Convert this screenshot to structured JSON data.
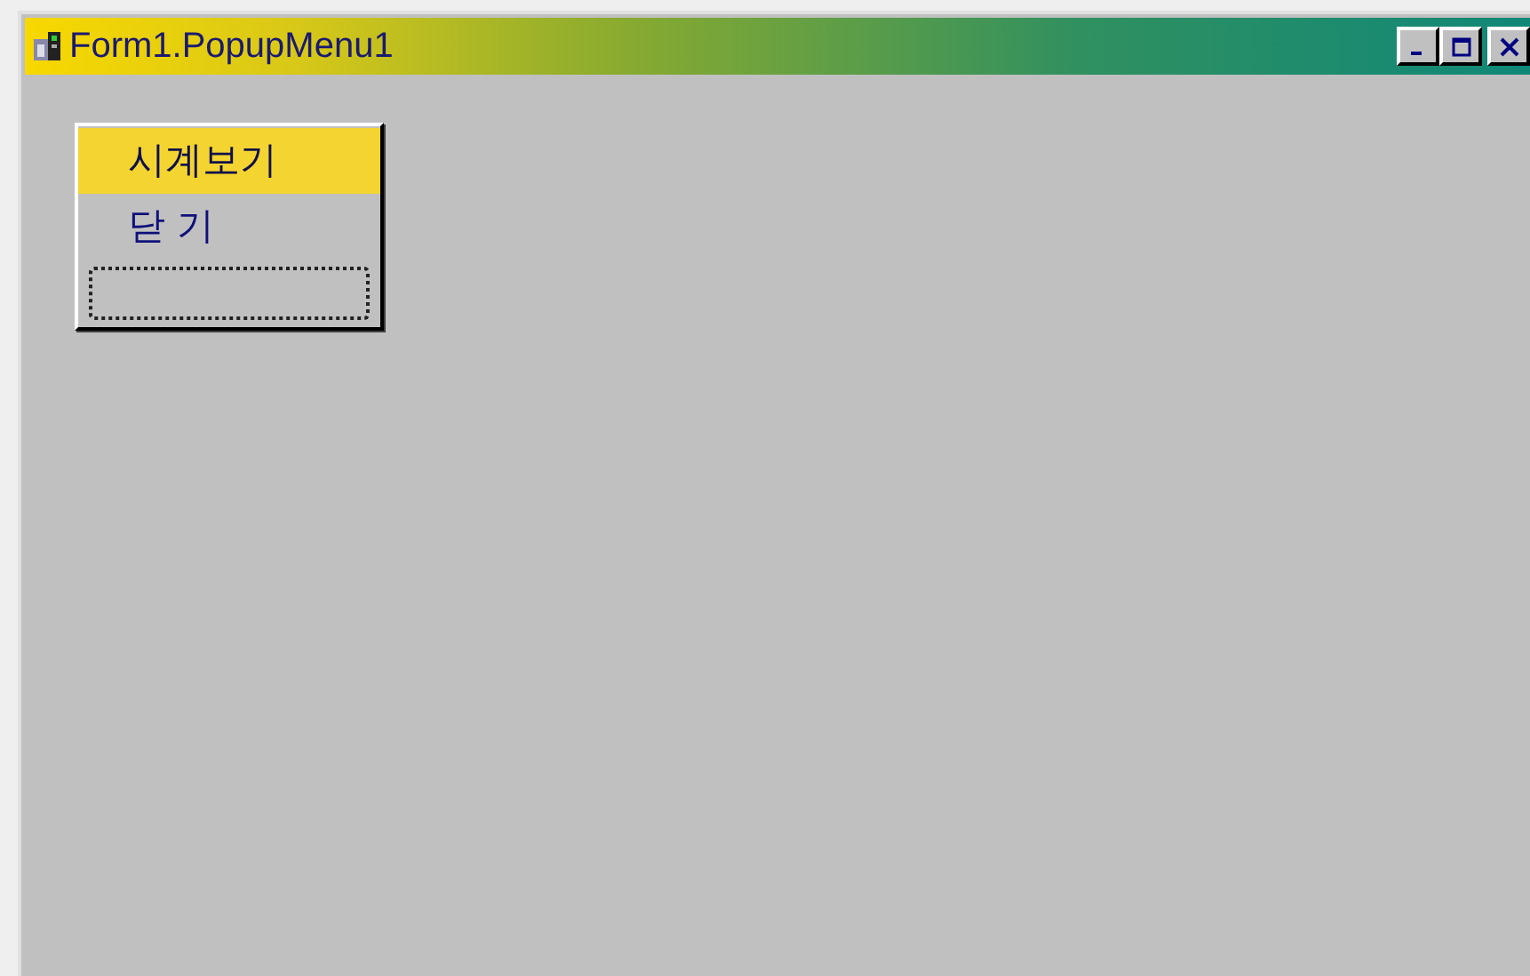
{
  "window": {
    "title": "Form1.PopupMenu1"
  },
  "title_buttons": [
    {
      "kind": "minimize"
    },
    {
      "kind": "maximize"
    },
    {
      "kind": "close"
    }
  ],
  "popup_menu": {
    "items": [
      {
        "kind": "text",
        "label": "시계보기",
        "selected": true
      },
      {
        "kind": "text",
        "label": "닫 기",
        "selected": false
      },
      {
        "kind": "blank",
        "selected": false,
        "focused": true
      }
    ]
  }
}
